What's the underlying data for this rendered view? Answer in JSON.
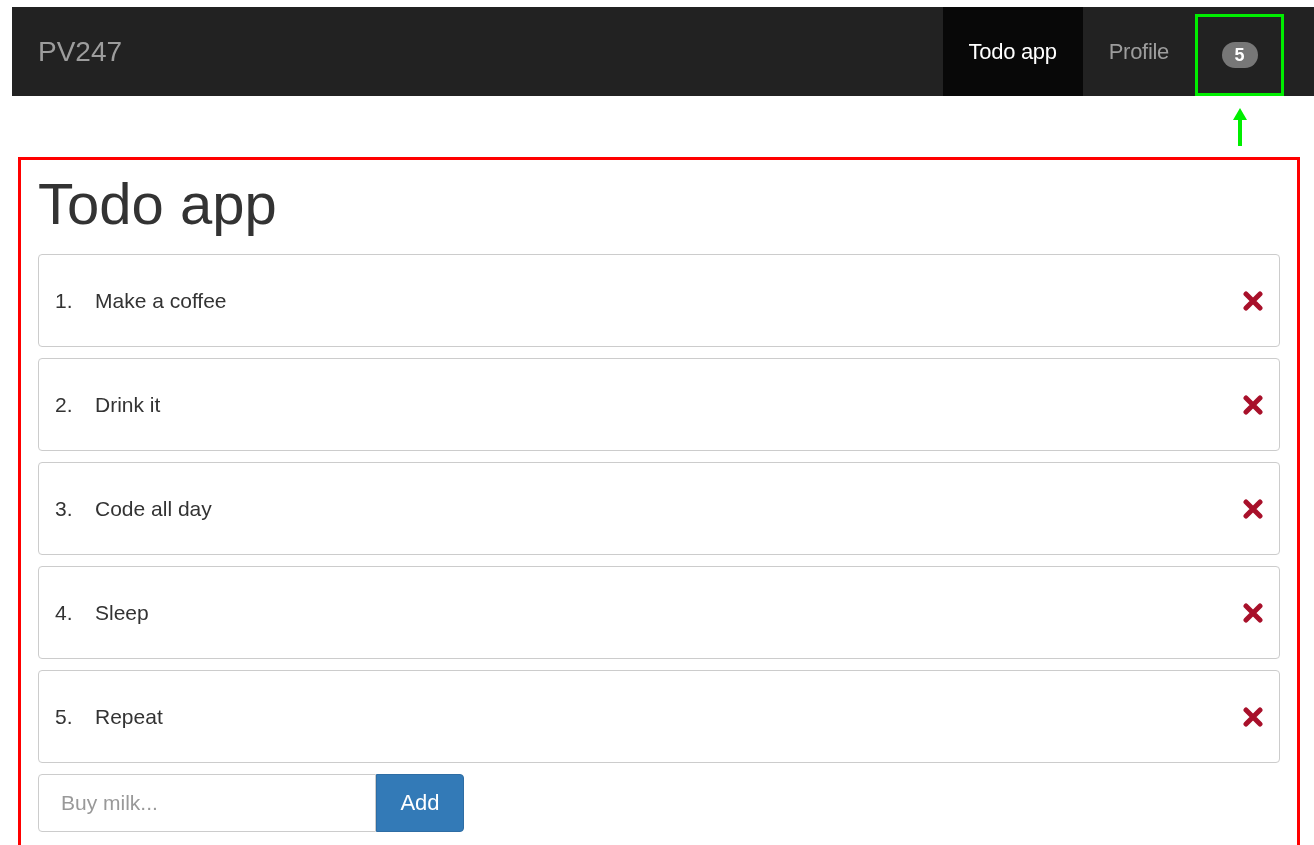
{
  "navbar": {
    "brand": "PV247",
    "items": [
      {
        "label": "Todo app",
        "selected": true,
        "kind": "link"
      },
      {
        "label": "Profile",
        "selected": false,
        "kind": "link"
      },
      {
        "label": "5",
        "selected": false,
        "kind": "badge"
      }
    ]
  },
  "highlights": {
    "badge": {
      "color": "#00ee00"
    },
    "content": {
      "color": "#ff0000"
    }
  },
  "page": {
    "title": "Todo app",
    "todos": [
      {
        "number": "1.",
        "text": "Make a coffee"
      },
      {
        "number": "2.",
        "text": "Drink it"
      },
      {
        "number": "3.",
        "text": "Code all day"
      },
      {
        "number": "4.",
        "text": "Sleep"
      },
      {
        "number": "5.",
        "text": "Repeat"
      }
    ],
    "new_todo": {
      "placeholder": "Buy milk..."
    },
    "add_button": "Add"
  }
}
